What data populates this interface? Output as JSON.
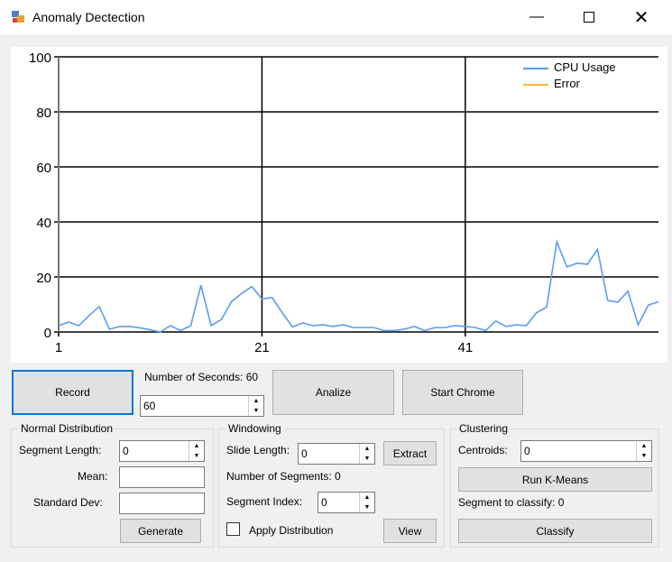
{
  "window": {
    "title": "Anomaly Dectection",
    "icon": "app-window-icon"
  },
  "chart_data": {
    "type": "line",
    "title": "",
    "xlabel": "",
    "ylabel": "",
    "xlim": [
      1,
      60
    ],
    "ylim": [
      0,
      100
    ],
    "grid": true,
    "legend_placement": "top-right",
    "x_ticks": [
      "1",
      "21",
      "41"
    ],
    "y_ticks": [
      "0",
      "20",
      "40",
      "60",
      "80",
      "100"
    ],
    "series": [
      {
        "name": "CPU Usage",
        "color": "#5b9bf5",
        "values": [
          2.3,
          3.6,
          2.3,
          6,
          9.2,
          1,
          2,
          2,
          1.5,
          0.8,
          0,
          2.3,
          0.5,
          2.3,
          17,
          2.3,
          4.5,
          11,
          14,
          16.5,
          12,
          12.5,
          7,
          1.8,
          3.3,
          2.3,
          2.6,
          2,
          2.6,
          1.6,
          1.6,
          1.6,
          0.5,
          0.5,
          1,
          2,
          0.5,
          1.6,
          1.6,
          2.3,
          2,
          1.6,
          0.5,
          4,
          2,
          2.6,
          2.3,
          7,
          9,
          32.8,
          23.6,
          25,
          24.6,
          30,
          11.5,
          10.8,
          14.8,
          2.6,
          9.8,
          11
        ]
      },
      {
        "name": "Error",
        "color": "#ffb432",
        "values": []
      }
    ]
  },
  "controls": {
    "record": "Record",
    "seconds_label": "Number of Seconds: 60",
    "seconds_value": "60",
    "analize": "Analize",
    "start_chrome": "Start Chrome"
  },
  "normal": {
    "title": "Normal Distribution",
    "segment_length_label": "Segment Length:",
    "segment_length": "0",
    "mean_label": "Mean:",
    "mean": "",
    "std_label": "Standard Dev:",
    "std": "",
    "generate": "Generate"
  },
  "windowing": {
    "title": "Windowing",
    "slide_label": "Slide Length:",
    "slide": "0",
    "extract": "Extract",
    "num_segments": "Number of Segments: 0",
    "segment_index_label": "Segment Index:",
    "segment_index": "0",
    "apply": "Apply Distribution",
    "apply_checked": false,
    "view": "View"
  },
  "clustering": {
    "title": "Clustering",
    "centroids_label": "Centroids:",
    "centroids": "0",
    "run": "Run K-Means",
    "segment_classify": "Segment to classify: 0",
    "classify": "Classify"
  }
}
